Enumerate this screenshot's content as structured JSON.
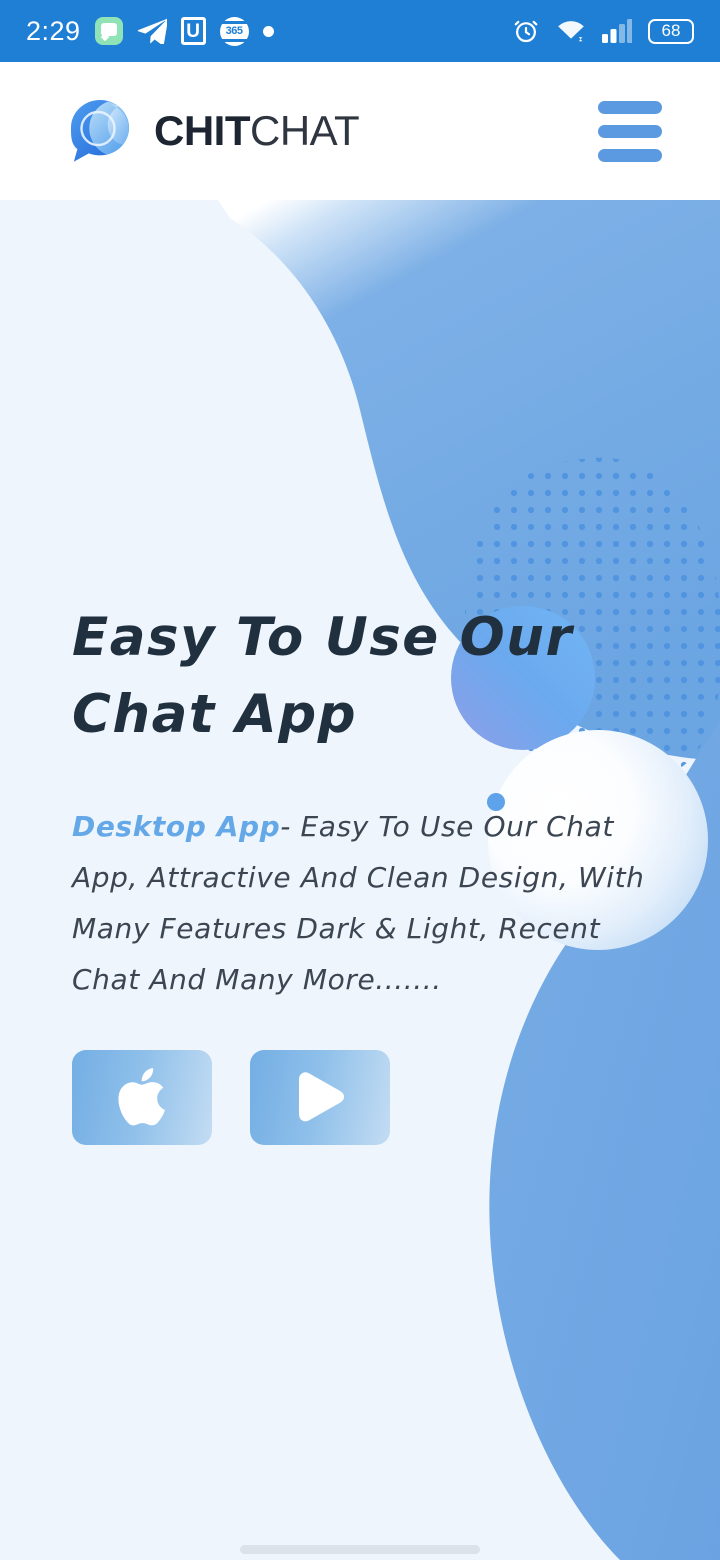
{
  "statusbar": {
    "time": "2:29",
    "battery_level": "68",
    "left_icons": [
      {
        "name": "messages-icon",
        "label": "messages"
      },
      {
        "name": "telegram-icon",
        "label": "telegram"
      },
      {
        "name": "u-app-icon",
        "label": "U"
      },
      {
        "name": "365-app-icon",
        "label": "365"
      },
      {
        "name": "more-notifications-dot-icon",
        "label": "•"
      }
    ],
    "right_icons": [
      {
        "name": "alarm-clock-icon",
        "label": "alarm"
      },
      {
        "name": "wifi-icon",
        "label": "wifi"
      },
      {
        "name": "cellular-signal-icon",
        "label": "signal"
      },
      {
        "name": "battery-icon",
        "label": "68"
      }
    ]
  },
  "header": {
    "logo_icon": "chat-bubble-logo-icon",
    "brand_bold": "CHIT",
    "brand_light": "CHAT",
    "menu_icon": "hamburger-menu-icon"
  },
  "hero": {
    "title": "Easy To Use Our Chat App",
    "desc_accent": "Desktop App",
    "desc_rest": "- Easy To Use Our Chat App, Attractive And Clean Design, With Many Features Dark & Light, Recent Chat And Many More.......",
    "buttons": [
      {
        "name": "app-store-button",
        "icon": "apple-icon",
        "label": "App Store"
      },
      {
        "name": "google-play-button",
        "icon": "play-triangle-icon",
        "label": "Google Play"
      }
    ]
  },
  "navigation": {
    "gesture_pill": "home-gesture-pill"
  },
  "colors": {
    "status_bar": "#1f7fd4",
    "hero_bg": "#eef5fc",
    "blob_blue": "#74aae4",
    "accent_text": "#64a8e8",
    "title_text": "#20303f",
    "body_text": "#3c4652",
    "menu_blue": "#5b9ae0"
  }
}
